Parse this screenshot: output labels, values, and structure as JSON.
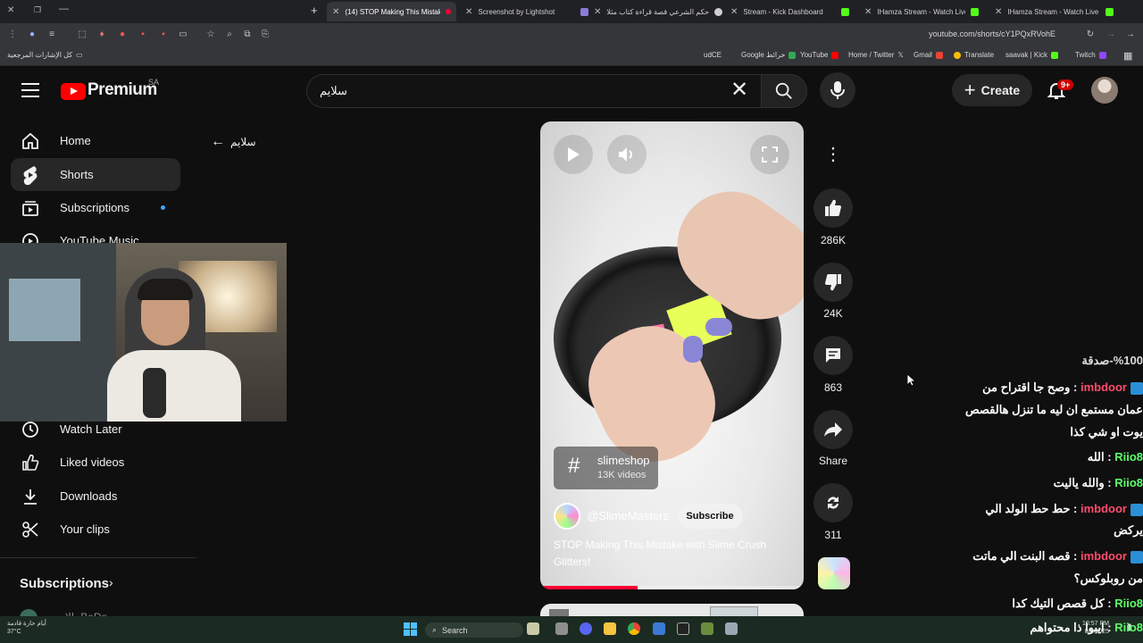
{
  "browser": {
    "tabs": [
      {
        "title": "(14) STOP Making This Mistake",
        "active": true
      },
      {
        "title": "Screenshot by Lightshot"
      },
      {
        "title": "حكم الشرعي قصة قراءة كتاب مثلا"
      },
      {
        "title": "Stream - Kick Dashboard"
      },
      {
        "title": "IHamza Stream - Watch Live on"
      },
      {
        "title": "IHamza Stream - Watch Live on"
      }
    ],
    "url": "youtube.com/shorts/cY1PQxRVohE",
    "bookmarks_left": "كل الإشارات المرجعية",
    "bookmarks": [
      "udCE",
      "Google خرائط",
      "YouTube",
      "Home / Twitter",
      "Gmail",
      "Translate",
      "saavak | Kick",
      "Twitch"
    ]
  },
  "header": {
    "logo_text": "Premium",
    "country_code": "SA",
    "search_value": "سلايم",
    "create_label": "Create",
    "notification_count": "9+"
  },
  "sidebar": {
    "items": [
      {
        "label": "Home",
        "icon": "home-icon"
      },
      {
        "label": "Shorts",
        "icon": "shorts-icon",
        "selected": true
      },
      {
        "label": "Subscriptions",
        "icon": "subscriptions-icon"
      },
      {
        "label": "YouTube Music",
        "icon": "youtube-music-icon"
      },
      {
        "label": "Watch Later",
        "icon": "clock-icon"
      },
      {
        "label": "Liked videos",
        "icon": "thumbs-up-icon"
      },
      {
        "label": "Downloads",
        "icon": "download-icon"
      },
      {
        "label": "Your clips",
        "icon": "scissors-icon"
      }
    ],
    "subscriptions_heading": "Subscriptions",
    "partial_channel": "ـالا ـ BeDo"
  },
  "back_label": "سلايم",
  "short": {
    "hashtag": "slimeshop",
    "hashtag_count": "13K videos",
    "channel": "@SlimeMasters",
    "subscribe_label": "Subscribe",
    "title": "STOP Making This Mistake with Slime Crush Glitters!",
    "progress": 0.37
  },
  "actions": {
    "likes": "286K",
    "dislikes": "24K",
    "comments": "863",
    "share_label": "Share",
    "remix": "311"
  },
  "chat": [
    {
      "text": "%100-صدقة",
      "partial": true
    },
    {
      "user": "imbdoor",
      "msg": "وصح جا اقتراح من"
    },
    {
      "text": "عمان مستمع ان ليه ما تنزل هالقصص"
    },
    {
      "text": "يوت او شي كذا"
    },
    {
      "user": "Riio8",
      "msg": "الله"
    },
    {
      "user": "Riio8",
      "msg": "والله ياليت"
    },
    {
      "user": "imbdoor",
      "msg": "حط حط الولد الي"
    },
    {
      "text": "يركض"
    },
    {
      "user": "imbdoor",
      "msg": "قصه البنت الي ماتت"
    },
    {
      "text": "من روبلوكس؟"
    },
    {
      "user": "Riio8",
      "msg": "كل قصص التيك كدا"
    },
    {
      "user": "Riio8",
      "msg": "ايبوا ذا محتواهم"
    }
  ],
  "taskbar": {
    "weather_line1": "أيام حارة قادمة",
    "weather_line2": "37°C",
    "search_label": "Search",
    "time": "10:57 PM",
    "date": "8/6/2025"
  }
}
